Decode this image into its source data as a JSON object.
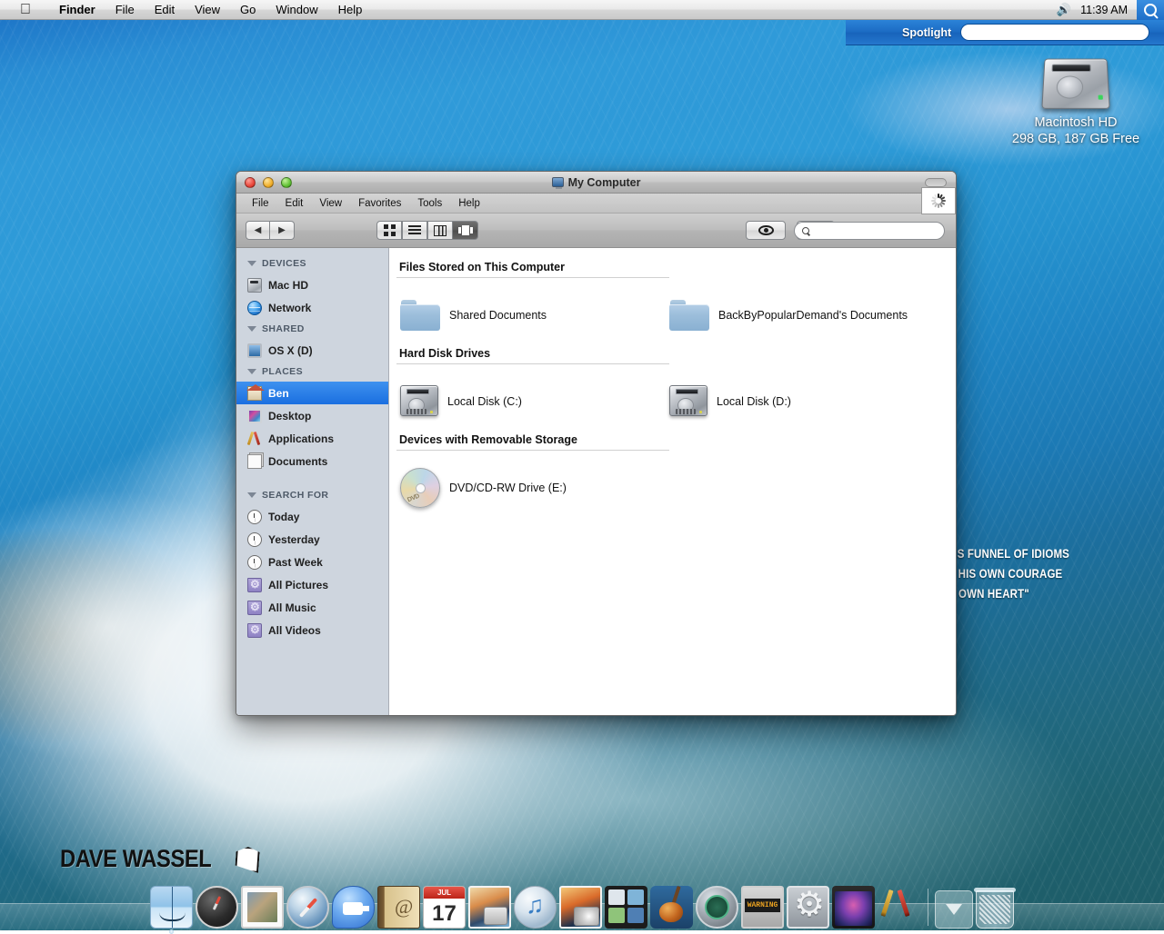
{
  "menubar": {
    "apple_icon": "apple-logo",
    "items": [
      {
        "label": "Finder",
        "bold": true
      },
      {
        "label": "File",
        "bold": false
      },
      {
        "label": "Edit",
        "bold": false
      },
      {
        "label": "View",
        "bold": false
      },
      {
        "label": "Go",
        "bold": false
      },
      {
        "label": "Window",
        "bold": false
      },
      {
        "label": "Help",
        "bold": false
      }
    ],
    "volume_icon": "speaker-icon",
    "clock": "11:39 AM",
    "spotlight_icon": "search-icon"
  },
  "spotlight": {
    "label": "Spotlight",
    "value": "",
    "placeholder": ""
  },
  "desktop": {
    "hd_icon": {
      "name": "Macintosh HD",
      "capacity": "298 GB, 187 GB Free"
    },
    "quote_lines": [
      "IKIND LIES A BLISS FUNNEL OF IDIOMS",
      "LD BY MEANS OF HIS OWN COURAGE",
      "E THEM WITH HIS OWN HEART\""
    ],
    "watermark": "DAVE WASSEL"
  },
  "window": {
    "title": "My Computer",
    "title_icon": "my-computer-icon",
    "traffic_lights": [
      "close",
      "minimize",
      "zoom"
    ],
    "menu": [
      "File",
      "Edit",
      "View",
      "Favorites",
      "Tools",
      "Help"
    ],
    "toolbar": {
      "back_label": "◀",
      "forward_label": "▶",
      "views": [
        {
          "name": "icon-view",
          "selected": false
        },
        {
          "name": "list-view",
          "selected": false
        },
        {
          "name": "column-view",
          "selected": false
        },
        {
          "name": "coverflow-view",
          "selected": true
        }
      ],
      "quicklook_icon": "eye-icon",
      "action_icon": "gear-icon",
      "search_value": "",
      "search_placeholder": "",
      "spinner": "busy-spinner"
    }
  },
  "sidebar": {
    "groups": [
      {
        "title": "DEVICES",
        "items": [
          {
            "label": "Mac HD",
            "icon": "harddisk-icon",
            "selected": false
          },
          {
            "label": "Network",
            "icon": "network-globe-icon",
            "selected": false
          }
        ]
      },
      {
        "title": "SHARED",
        "items": [
          {
            "label": "OS X (D)",
            "icon": "monitor-icon",
            "selected": false
          }
        ]
      },
      {
        "title": "PLACES",
        "items": [
          {
            "label": "Ben",
            "icon": "home-icon",
            "selected": true
          },
          {
            "label": "Desktop",
            "icon": "desktop-picture-icon",
            "selected": false
          },
          {
            "label": "Applications",
            "icon": "applications-icon",
            "selected": false
          },
          {
            "label": "Documents",
            "icon": "document-icon",
            "selected": false
          }
        ]
      },
      {
        "title": "SEARCH FOR",
        "items": [
          {
            "label": "Today",
            "icon": "clock-icon",
            "selected": false
          },
          {
            "label": "Yesterday",
            "icon": "clock-icon",
            "selected": false
          },
          {
            "label": "Past Week",
            "icon": "clock-icon",
            "selected": false
          },
          {
            "label": "All Pictures",
            "icon": "smart-folder-icon",
            "selected": false
          },
          {
            "label": "All Music",
            "icon": "smart-folder-icon",
            "selected": false
          },
          {
            "label": "All Videos",
            "icon": "smart-folder-icon",
            "selected": false
          }
        ]
      }
    ]
  },
  "content": {
    "sections": [
      {
        "heading": "Files Stored on This Computer",
        "items": [
          {
            "label": "Shared Documents",
            "icon": "folder-icon"
          },
          {
            "label": "BackByPopularDemand's Documents",
            "icon": "folder-icon"
          }
        ]
      },
      {
        "heading": "Hard Disk Drives",
        "items": [
          {
            "label": "Local Disk (C:)",
            "icon": "harddisk-icon"
          },
          {
            "label": "Local Disk (D:)",
            "icon": "harddisk-icon"
          }
        ]
      },
      {
        "heading": "Devices with Removable Storage",
        "items": [
          {
            "label": "DVD/CD-RW Drive (E:)",
            "icon": "dvd-drive-icon"
          }
        ]
      }
    ]
  },
  "dock": {
    "items": [
      {
        "name": "finder",
        "class": "di-finder",
        "running": true
      },
      {
        "name": "dashboard",
        "class": "di-dashboard",
        "running": false
      },
      {
        "name": "mail",
        "class": "di-mail",
        "running": false
      },
      {
        "name": "safari",
        "class": "di-safari",
        "running": false
      },
      {
        "name": "ichat",
        "class": "di-ichat",
        "running": false
      },
      {
        "name": "address-book",
        "class": "di-addressbook",
        "running": false
      },
      {
        "name": "ical",
        "class": "di-ical",
        "running": false
      },
      {
        "name": "iphoto",
        "class": "di-iphoto",
        "running": false
      },
      {
        "name": "itunes",
        "class": "di-itunes",
        "running": false
      },
      {
        "name": "photo-booth",
        "class": "di-iphoto2",
        "running": false
      },
      {
        "name": "spaces",
        "class": "di-spaces",
        "running": false
      },
      {
        "name": "garageband",
        "class": "di-garageband",
        "running": false
      },
      {
        "name": "time-machine",
        "class": "di-timemachine",
        "running": false
      },
      {
        "name": "alarm-clock",
        "class": "di-clock",
        "running": false
      },
      {
        "name": "system-preferences",
        "class": "di-syspref",
        "running": false
      },
      {
        "name": "front-row",
        "class": "di-display",
        "running": false
      },
      {
        "name": "xcode",
        "class": "di-xcode",
        "running": false
      }
    ],
    "stack": {
      "name": "downloads-stack",
      "class": "di-stack"
    },
    "trash": {
      "name": "trash",
      "class": "di-trash"
    }
  },
  "colors": {
    "accent": "#1a6fe0",
    "spotlight_blue": "#1c6cc4",
    "sidebar_bg": "#ced5de",
    "window_chrome": "#bdbdbd"
  }
}
